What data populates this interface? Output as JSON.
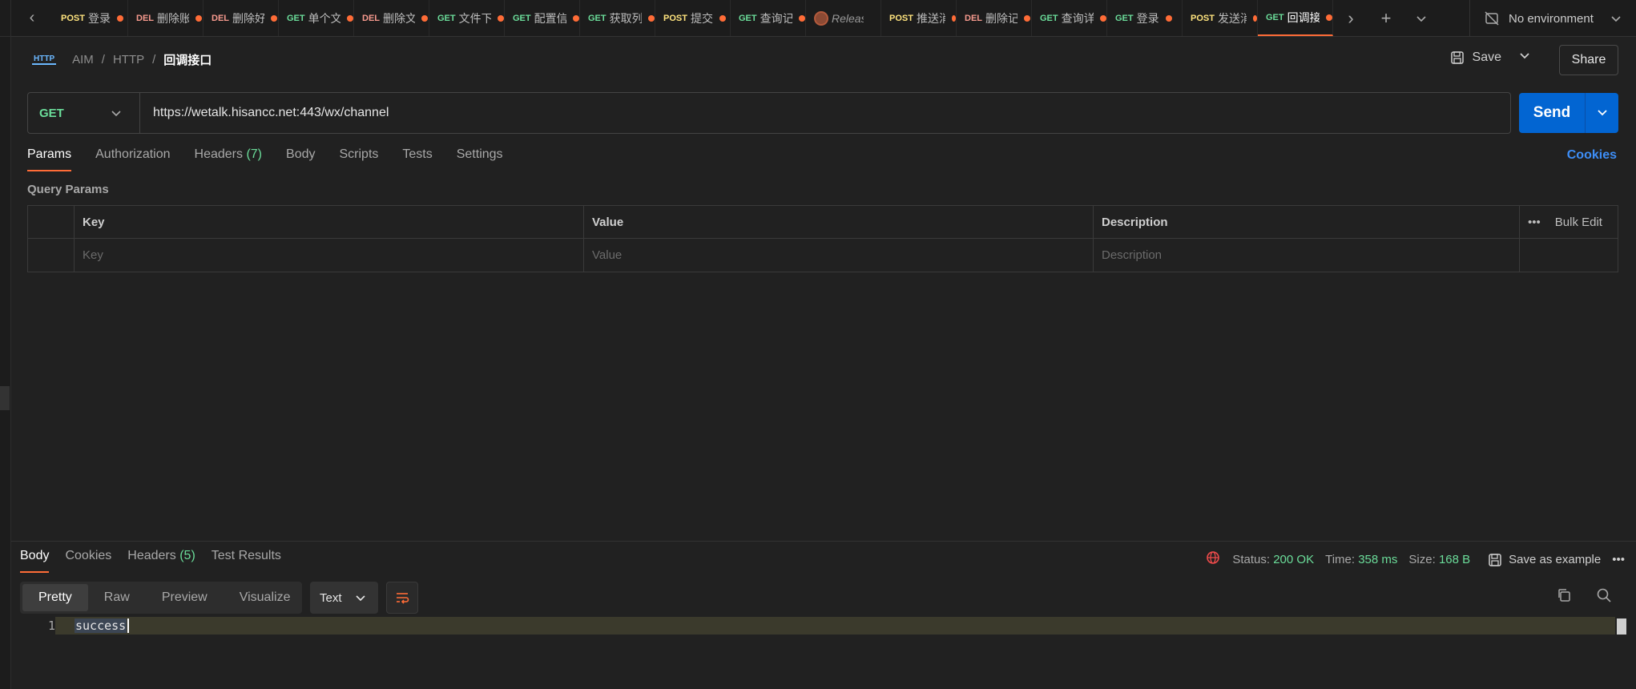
{
  "tabs": [
    {
      "method": "POST",
      "title": "登录",
      "dirty": true
    },
    {
      "method": "DEL",
      "title": "删除账号",
      "dirty": true
    },
    {
      "method": "DEL",
      "title": "删除好友",
      "dirty": true
    },
    {
      "method": "GET",
      "title": "单个文件",
      "dirty": true
    },
    {
      "method": "DEL",
      "title": "删除文件",
      "dirty": true
    },
    {
      "method": "GET",
      "title": "文件下载",
      "dirty": true
    },
    {
      "method": "GET",
      "title": "配置信息",
      "dirty": true
    },
    {
      "method": "GET",
      "title": "获取列表",
      "dirty": true
    },
    {
      "method": "POST",
      "title": "提交",
      "dirty": true
    },
    {
      "method": "GET",
      "title": "查询记录",
      "dirty": true
    },
    {
      "method": "",
      "title": "Release",
      "dirty": false,
      "special": "release"
    },
    {
      "method": "POST",
      "title": "推送消息",
      "dirty": true
    },
    {
      "method": "DEL",
      "title": "删除记录",
      "dirty": true
    },
    {
      "method": "GET",
      "title": "查询详情",
      "dirty": true
    },
    {
      "method": "GET",
      "title": "登录",
      "dirty": true
    },
    {
      "method": "POST",
      "title": "发送消息",
      "dirty": true
    },
    {
      "method": "GET",
      "title": "回调接口",
      "dirty": true,
      "active": true
    }
  ],
  "environment": {
    "label": "No environment"
  },
  "breadcrumb": {
    "badge": "HTTP",
    "items": [
      "AIM",
      "HTTP"
    ],
    "current": "回调接口"
  },
  "actions": {
    "save": "Save",
    "share": "Share"
  },
  "request": {
    "method": "GET",
    "url": "https://wetalk.hisancc.net:443/wx/channel",
    "send": "Send"
  },
  "request_tabs": [
    {
      "label": "Params",
      "active": true
    },
    {
      "label": "Authorization"
    },
    {
      "label": "Headers",
      "count": "(7)"
    },
    {
      "label": "Body"
    },
    {
      "label": "Scripts"
    },
    {
      "label": "Tests"
    },
    {
      "label": "Settings"
    }
  ],
  "cookies_link": "Cookies",
  "query_params": {
    "title": "Query Params",
    "columns": [
      "Key",
      "Value",
      "Description"
    ],
    "bulk_edit": "Bulk Edit",
    "placeholders": [
      "Key",
      "Value",
      "Description"
    ]
  },
  "response": {
    "tabs": [
      {
        "label": "Body",
        "active": true
      },
      {
        "label": "Cookies"
      },
      {
        "label": "Headers",
        "count": "(5)"
      },
      {
        "label": "Test Results"
      }
    ],
    "status_label": "Status:",
    "status": "200 OK",
    "time_label": "Time:",
    "time": "358 ms",
    "size_label": "Size:",
    "size": "168 B",
    "save_example": "Save as example",
    "views": [
      "Pretty",
      "Raw",
      "Preview",
      "Visualize"
    ],
    "format": "Text",
    "body_lines": [
      {
        "n": "1",
        "text": "success"
      }
    ]
  }
}
